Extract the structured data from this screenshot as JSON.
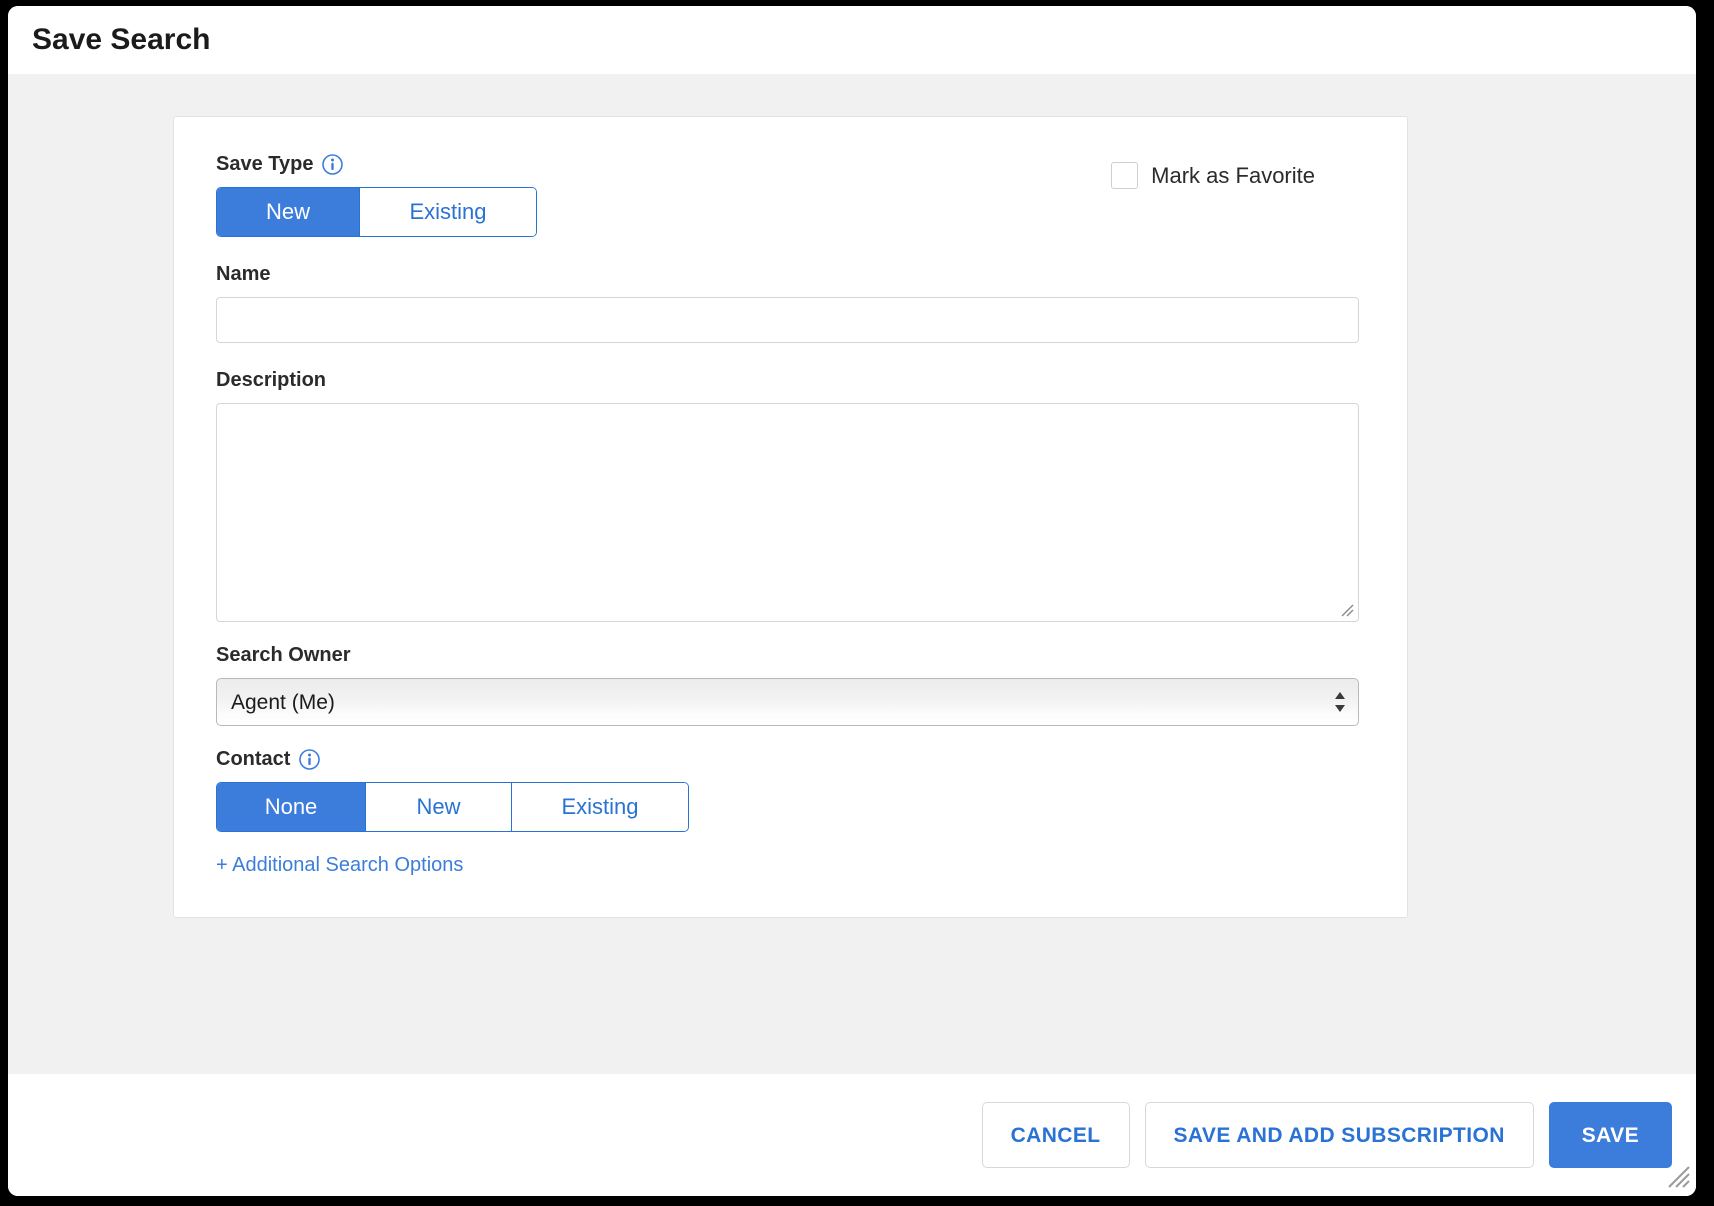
{
  "window": {
    "title": "Save Search"
  },
  "form": {
    "save_type": {
      "label": "Save Type",
      "info_icon": "info-circle-icon",
      "options": [
        "New",
        "Existing"
      ],
      "selected": "New"
    },
    "favorite": {
      "label": "Mark as Favorite",
      "checked": false
    },
    "name": {
      "label": "Name",
      "value": "",
      "placeholder": ""
    },
    "description": {
      "label": "Description",
      "value": "",
      "placeholder": ""
    },
    "search_owner": {
      "label": "Search Owner",
      "selected": "Agent (Me)",
      "options": [
        "Agent (Me)"
      ]
    },
    "contact": {
      "label": "Contact",
      "info_icon": "info-circle-icon",
      "options": [
        "None",
        "New",
        "Existing"
      ],
      "selected": "None"
    },
    "additional_options_link": "+ Additional Search Options"
  },
  "footer": {
    "cancel_label": "CANCEL",
    "save_and_subscribe_label": "SAVE AND ADD SUBSCRIPTION",
    "save_label": "SAVE"
  },
  "colors": {
    "accent": "#3c7ddb",
    "link": "#2a72d4",
    "body_bg": "#f1f1f1",
    "text": "#2b2b2b"
  }
}
